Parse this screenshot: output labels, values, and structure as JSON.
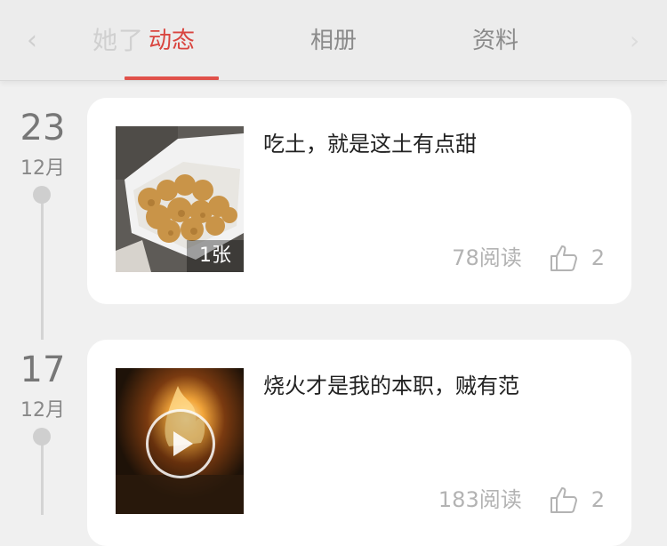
{
  "header": {
    "ghost_title": "她了",
    "tabs": [
      {
        "label": "动态",
        "active": true
      },
      {
        "label": "相册",
        "active": false
      },
      {
        "label": "资料",
        "active": false
      }
    ]
  },
  "posts": [
    {
      "day": "23",
      "month": "12月",
      "text": "吃土，就是这土有点甜",
      "media_type": "image",
      "image_count": "1张",
      "reads": "78阅读",
      "likes": "2"
    },
    {
      "day": "17",
      "month": "12月",
      "text": "烧火才是我的本职，贼有范",
      "media_type": "video",
      "reads": "183阅读",
      "likes": "2"
    }
  ],
  "colors": {
    "accent": "#d9453f",
    "background": "#f0f0f0",
    "card": "#ffffff",
    "muted": "#b3b3b3"
  },
  "icons": {
    "like": "thumbs-up-icon",
    "play": "play-icon",
    "back": "back-icon",
    "forward": "chevron-right-icon"
  }
}
